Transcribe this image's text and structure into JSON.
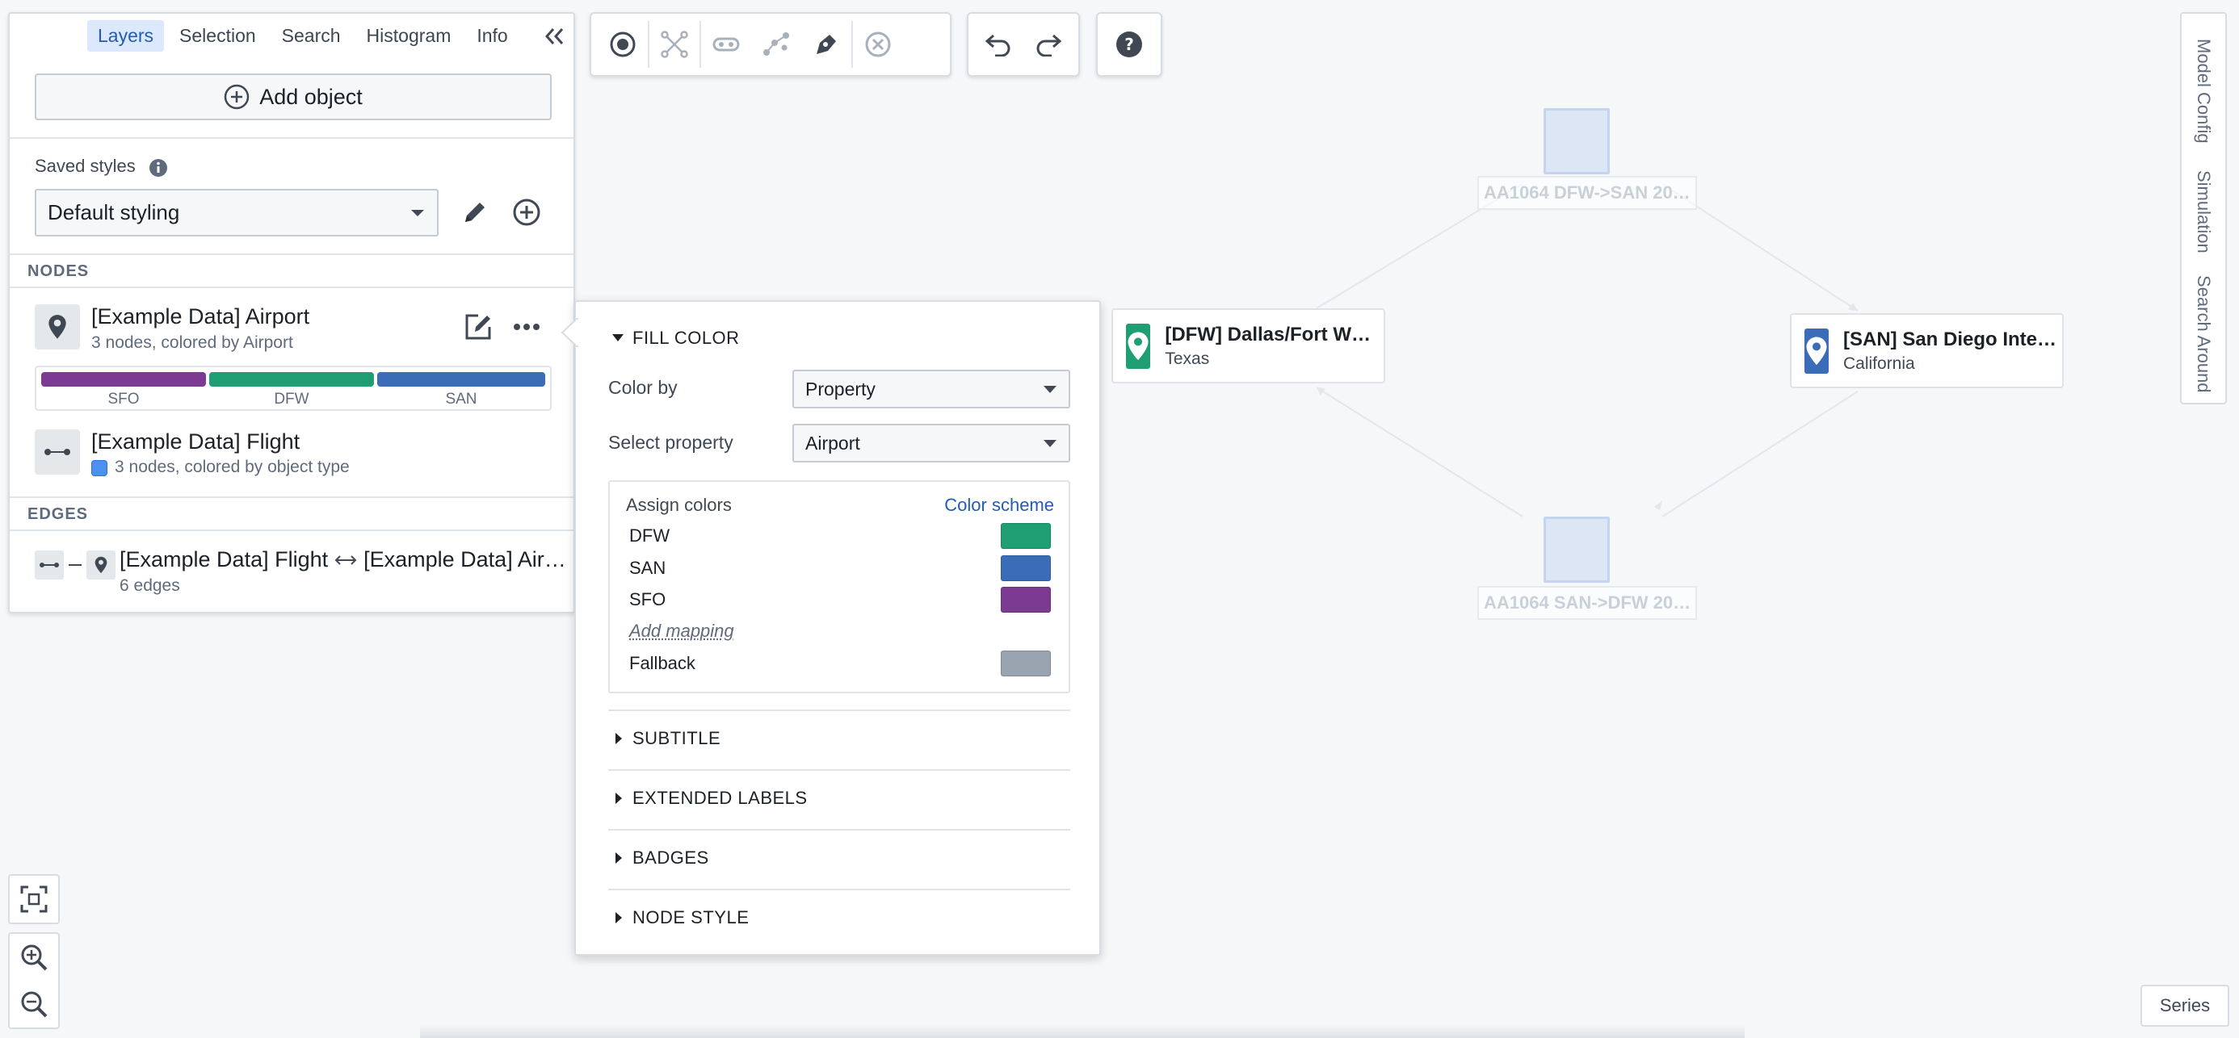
{
  "left_panel": {
    "tabs": [
      {
        "label": "Layers",
        "active": true
      },
      {
        "label": "Selection",
        "active": false
      },
      {
        "label": "Search",
        "active": false
      },
      {
        "label": "Histogram",
        "active": false
      },
      {
        "label": "Info",
        "active": false
      }
    ],
    "add_object_label": "Add object",
    "saved_styles_label": "Saved styles",
    "saved_styles_value": "Default styling",
    "nodes_heading": "NODES",
    "edges_heading": "EDGES",
    "layers": {
      "airport": {
        "title": "[Example Data] Airport",
        "subtitle": "3 nodes, colored by Airport",
        "legend": [
          {
            "label": "SFO",
            "color": "#7c3a92",
            "fraction": 0.3333
          },
          {
            "label": "DFW",
            "color": "#1e9e72",
            "fraction": 0.3333
          },
          {
            "label": "SAN",
            "color": "#3a6cb8",
            "fraction": 0.3334
          }
        ]
      },
      "flight": {
        "title": "[Example Data] Flight",
        "subtitle": "3 nodes, colored by object type",
        "dot_color": "#4c90f0"
      },
      "edge": {
        "title_left": "[Example Data] Flight",
        "title_right": "[Example Data] Air…",
        "subtitle": "6 edges"
      }
    }
  },
  "popover": {
    "fill_color_heading": "FILL COLOR",
    "color_by_label": "Color by",
    "color_by_value": "Property",
    "select_property_label": "Select property",
    "select_property_value": "Airport",
    "assign_colors_label": "Assign colors",
    "color_scheme_link": "Color scheme",
    "mappings": [
      {
        "key": "DFW",
        "color": "#1e9e72"
      },
      {
        "key": "SAN",
        "color": "#3a6cb8"
      },
      {
        "key": "SFO",
        "color": "#7c3a92"
      }
    ],
    "add_mapping_label": "Add mapping",
    "fallback_label": "Fallback",
    "fallback_color": "#9aa3b0",
    "sections": [
      "SUBTITLE",
      "EXTENDED LABELS",
      "BADGES",
      "NODE STYLE"
    ]
  },
  "graph": {
    "nodes": {
      "dfw": {
        "title": "[DFW] Dallas/Fort W…",
        "subtitle": "Texas",
        "color": "#1e9e72"
      },
      "san": {
        "title": "[SAN] San Diego Inte…",
        "subtitle": "California",
        "color": "#3a6cb8"
      }
    },
    "flight_nodes": {
      "top": "AA1064 DFW->SAN 20…",
      "bottom": "AA1064 SAN->DFW 20…"
    }
  },
  "right_tabs": [
    "Model Config",
    "Simulation",
    "Search Around"
  ],
  "series_label": "Series",
  "colors": {
    "accent": "#215db0",
    "active_tab_bg": "#dce8fb"
  }
}
